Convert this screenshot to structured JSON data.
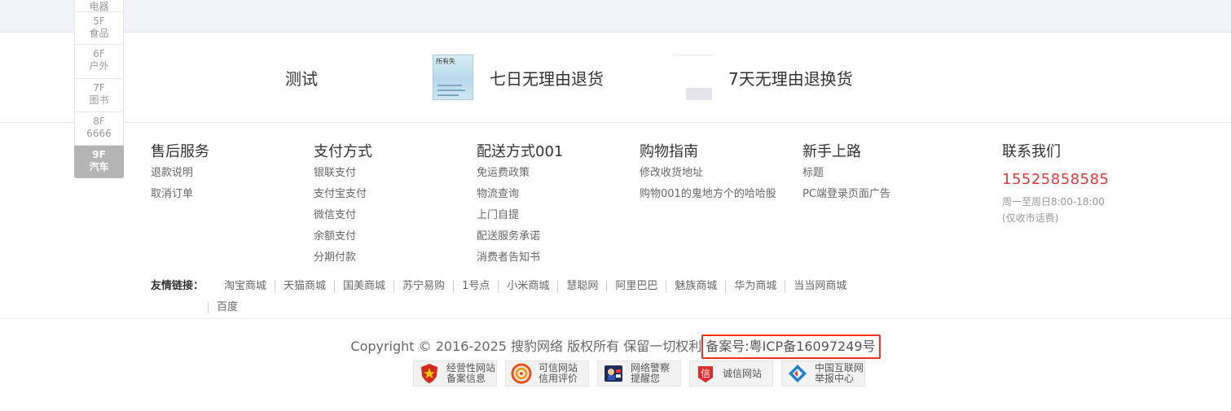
{
  "floors": [
    {
      "num": "",
      "name": "电器"
    },
    {
      "num": "5F",
      "name": "食品"
    },
    {
      "num": "6F",
      "name": "户外"
    },
    {
      "num": "7F",
      "name": "图书"
    },
    {
      "num": "8F",
      "name": "6666"
    },
    {
      "num": "9F",
      "name": "汽车"
    }
  ],
  "service": {
    "item1": "测试",
    "item2": "七日无理由退货",
    "item3": "7天无理由退换货",
    "book_cover_text": "所有失"
  },
  "columns": [
    {
      "head": "售后服务",
      "links": [
        "退款说明",
        "取消订单"
      ]
    },
    {
      "head": "支付方式",
      "links": [
        "银联支付",
        "支付宝支付",
        "微信支付",
        "余额支付",
        "分期付款"
      ]
    },
    {
      "head": "配送方式001",
      "links": [
        "免运费政策",
        "物流查询",
        "上门自提",
        "配送服务承诺",
        "消费者告知书"
      ]
    },
    {
      "head": "购物指南",
      "links": [
        "修改收货地址",
        "购物001的鬼地方个的哈哈股"
      ]
    },
    {
      "head": "新手上路",
      "links": [
        "标题",
        "PC端登录页面广告"
      ]
    }
  ],
  "contact": {
    "head": "联系我们",
    "phone": "15525858585",
    "hours": "周一至周日8:00-18:00",
    "note": "(仅收市话费)"
  },
  "friends": {
    "label": "友情链接：",
    "links": [
      "淘宝商城",
      "天猫商城",
      "国美商城",
      "苏宁易购",
      "1号点",
      "小米商城",
      "慧聪网",
      "阿里巴巴",
      "魅族商城",
      "华为商城",
      "当当网商城"
    ],
    "links_row2": [
      "百度"
    ]
  },
  "copyright": {
    "text": "Copyright © 2016-2025 搜豹网络 版权所有 保留一切权利",
    "icp": "备案号:粤ICP备16097249号"
  },
  "badges": [
    {
      "line1": "经营性网站",
      "line2": "备案信息",
      "icon": "police-emblem-icon"
    },
    {
      "line1": "可信网站",
      "line2": "信用评价",
      "icon": "trust-seal-icon"
    },
    {
      "line1": "网络警察",
      "line2": "提醒您",
      "icon": "cyber-police-icon"
    },
    {
      "line1": "诚信网站",
      "line2": "",
      "icon": "integrity-icon"
    },
    {
      "line1": "中国互联网",
      "line2": "举报中心",
      "icon": "report-center-icon"
    }
  ],
  "colors": {
    "accent_red": "#e4393c",
    "icp_border": "#e32222",
    "floor_active": "#b4b4b4"
  }
}
